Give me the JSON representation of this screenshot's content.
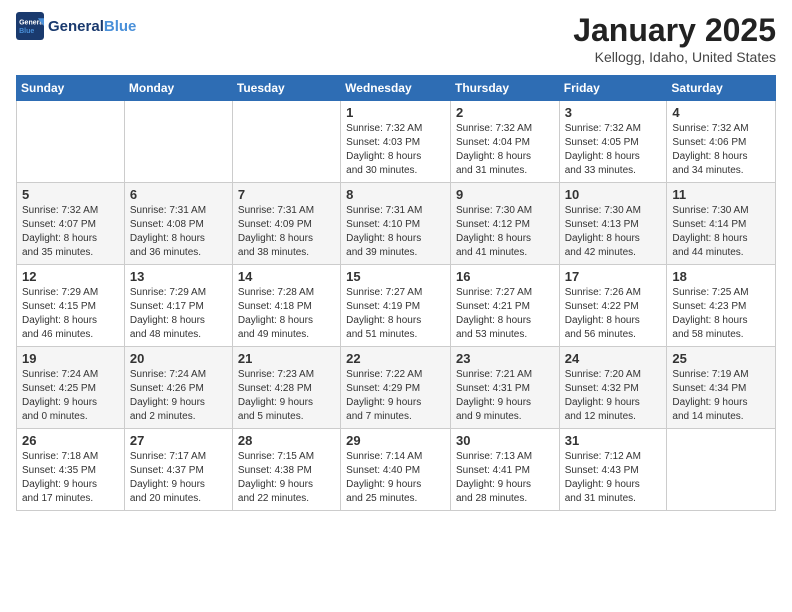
{
  "header": {
    "logo_line1": "General",
    "logo_line2": "Blue",
    "month_title": "January 2025",
    "location": "Kellogg, Idaho, United States"
  },
  "weekdays": [
    "Sunday",
    "Monday",
    "Tuesday",
    "Wednesday",
    "Thursday",
    "Friday",
    "Saturday"
  ],
  "weeks": [
    [
      {
        "day": "",
        "info": ""
      },
      {
        "day": "",
        "info": ""
      },
      {
        "day": "",
        "info": ""
      },
      {
        "day": "1",
        "info": "Sunrise: 7:32 AM\nSunset: 4:03 PM\nDaylight: 8 hours\nand 30 minutes."
      },
      {
        "day": "2",
        "info": "Sunrise: 7:32 AM\nSunset: 4:04 PM\nDaylight: 8 hours\nand 31 minutes."
      },
      {
        "day": "3",
        "info": "Sunrise: 7:32 AM\nSunset: 4:05 PM\nDaylight: 8 hours\nand 33 minutes."
      },
      {
        "day": "4",
        "info": "Sunrise: 7:32 AM\nSunset: 4:06 PM\nDaylight: 8 hours\nand 34 minutes."
      }
    ],
    [
      {
        "day": "5",
        "info": "Sunrise: 7:32 AM\nSunset: 4:07 PM\nDaylight: 8 hours\nand 35 minutes."
      },
      {
        "day": "6",
        "info": "Sunrise: 7:31 AM\nSunset: 4:08 PM\nDaylight: 8 hours\nand 36 minutes."
      },
      {
        "day": "7",
        "info": "Sunrise: 7:31 AM\nSunset: 4:09 PM\nDaylight: 8 hours\nand 38 minutes."
      },
      {
        "day": "8",
        "info": "Sunrise: 7:31 AM\nSunset: 4:10 PM\nDaylight: 8 hours\nand 39 minutes."
      },
      {
        "day": "9",
        "info": "Sunrise: 7:30 AM\nSunset: 4:12 PM\nDaylight: 8 hours\nand 41 minutes."
      },
      {
        "day": "10",
        "info": "Sunrise: 7:30 AM\nSunset: 4:13 PM\nDaylight: 8 hours\nand 42 minutes."
      },
      {
        "day": "11",
        "info": "Sunrise: 7:30 AM\nSunset: 4:14 PM\nDaylight: 8 hours\nand 44 minutes."
      }
    ],
    [
      {
        "day": "12",
        "info": "Sunrise: 7:29 AM\nSunset: 4:15 PM\nDaylight: 8 hours\nand 46 minutes."
      },
      {
        "day": "13",
        "info": "Sunrise: 7:29 AM\nSunset: 4:17 PM\nDaylight: 8 hours\nand 48 minutes."
      },
      {
        "day": "14",
        "info": "Sunrise: 7:28 AM\nSunset: 4:18 PM\nDaylight: 8 hours\nand 49 minutes."
      },
      {
        "day": "15",
        "info": "Sunrise: 7:27 AM\nSunset: 4:19 PM\nDaylight: 8 hours\nand 51 minutes."
      },
      {
        "day": "16",
        "info": "Sunrise: 7:27 AM\nSunset: 4:21 PM\nDaylight: 8 hours\nand 53 minutes."
      },
      {
        "day": "17",
        "info": "Sunrise: 7:26 AM\nSunset: 4:22 PM\nDaylight: 8 hours\nand 56 minutes."
      },
      {
        "day": "18",
        "info": "Sunrise: 7:25 AM\nSunset: 4:23 PM\nDaylight: 8 hours\nand 58 minutes."
      }
    ],
    [
      {
        "day": "19",
        "info": "Sunrise: 7:24 AM\nSunset: 4:25 PM\nDaylight: 9 hours\nand 0 minutes."
      },
      {
        "day": "20",
        "info": "Sunrise: 7:24 AM\nSunset: 4:26 PM\nDaylight: 9 hours\nand 2 minutes."
      },
      {
        "day": "21",
        "info": "Sunrise: 7:23 AM\nSunset: 4:28 PM\nDaylight: 9 hours\nand 5 minutes."
      },
      {
        "day": "22",
        "info": "Sunrise: 7:22 AM\nSunset: 4:29 PM\nDaylight: 9 hours\nand 7 minutes."
      },
      {
        "day": "23",
        "info": "Sunrise: 7:21 AM\nSunset: 4:31 PM\nDaylight: 9 hours\nand 9 minutes."
      },
      {
        "day": "24",
        "info": "Sunrise: 7:20 AM\nSunset: 4:32 PM\nDaylight: 9 hours\nand 12 minutes."
      },
      {
        "day": "25",
        "info": "Sunrise: 7:19 AM\nSunset: 4:34 PM\nDaylight: 9 hours\nand 14 minutes."
      }
    ],
    [
      {
        "day": "26",
        "info": "Sunrise: 7:18 AM\nSunset: 4:35 PM\nDaylight: 9 hours\nand 17 minutes."
      },
      {
        "day": "27",
        "info": "Sunrise: 7:17 AM\nSunset: 4:37 PM\nDaylight: 9 hours\nand 20 minutes."
      },
      {
        "day": "28",
        "info": "Sunrise: 7:15 AM\nSunset: 4:38 PM\nDaylight: 9 hours\nand 22 minutes."
      },
      {
        "day": "29",
        "info": "Sunrise: 7:14 AM\nSunset: 4:40 PM\nDaylight: 9 hours\nand 25 minutes."
      },
      {
        "day": "30",
        "info": "Sunrise: 7:13 AM\nSunset: 4:41 PM\nDaylight: 9 hours\nand 28 minutes."
      },
      {
        "day": "31",
        "info": "Sunrise: 7:12 AM\nSunset: 4:43 PM\nDaylight: 9 hours\nand 31 minutes."
      },
      {
        "day": "",
        "info": ""
      }
    ]
  ]
}
